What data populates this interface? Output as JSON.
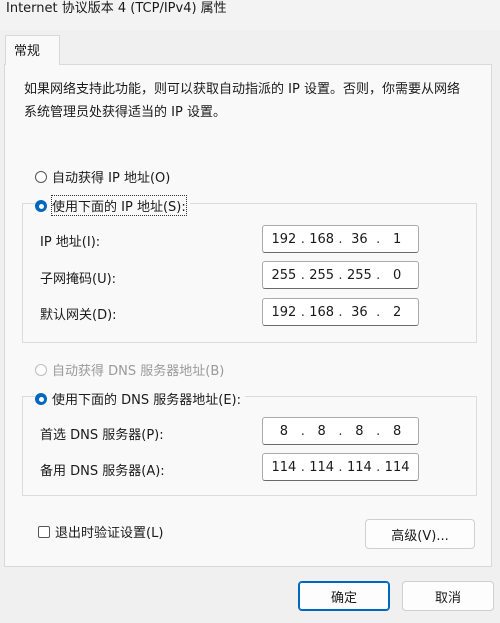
{
  "window": {
    "title": "Internet 协议版本 4 (TCP/IPv4) 属性"
  },
  "tab": {
    "label": "常规"
  },
  "description": "如果网络支持此功能，则可以获取自动指派的 IP 设置。否则，你需要从网络系统管理员处获得适当的 IP 设置。",
  "ip": {
    "auto_label": "自动获得 IP 地址(O)",
    "manual_label": "使用下面的 IP 地址(S):",
    "mode": "manual",
    "fields": [
      {
        "label": "IP 地址(I):",
        "octets": [
          "192",
          "168",
          "36",
          "1"
        ]
      },
      {
        "label": "子网掩码(U):",
        "octets": [
          "255",
          "255",
          "255",
          "0"
        ]
      },
      {
        "label": "默认网关(D):",
        "octets": [
          "192",
          "168",
          "36",
          "2"
        ]
      }
    ]
  },
  "dns": {
    "auto_label": "自动获得 DNS 服务器地址(B)",
    "manual_label": "使用下面的 DNS 服务器地址(E):",
    "mode": "manual",
    "auto_disabled": true,
    "fields": [
      {
        "label": "首选 DNS 服务器(P):",
        "octets": [
          "8",
          "8",
          "8",
          "8"
        ]
      },
      {
        "label": "备用 DNS 服务器(A):",
        "octets": [
          "114",
          "114",
          "114",
          "114"
        ]
      }
    ]
  },
  "validate": {
    "label": "退出时验证设置(L)",
    "checked": false
  },
  "buttons": {
    "advanced": "高级(V)...",
    "ok": "确定",
    "cancel": "取消"
  },
  "colors": {
    "accent": "#0067c0"
  }
}
